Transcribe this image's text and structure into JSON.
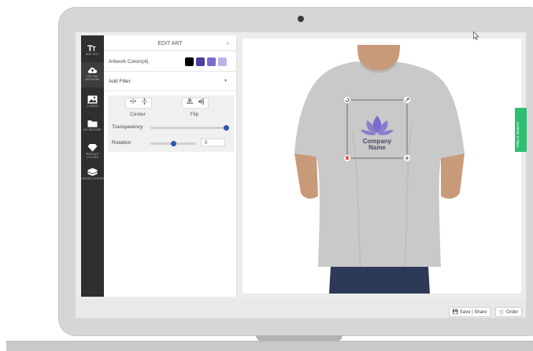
{
  "sidebar": {
    "items": [
      {
        "label": "ADD TEXT",
        "icon": "text-icon"
      },
      {
        "label": "UPLOAD ARTWORK",
        "icon": "cloud-upload-icon"
      },
      {
        "label": "CLIPART",
        "icon": "image-icon"
      },
      {
        "label": "MY DESIGNS",
        "icon": "folder-icon"
      },
      {
        "label": "PRODUCT COLORS",
        "icon": "diamond-icon"
      },
      {
        "label": "DESIGN LAYERS",
        "icon": "layers-icon"
      }
    ]
  },
  "panel": {
    "title": "EDIT ART",
    "close": "×",
    "artwork_colors_label": "Artwork Colors(4)",
    "artwork_colors": [
      "#000000",
      "#4b3fa0",
      "#7b6ad0",
      "#b9b2ec"
    ],
    "filter_label": "Add Filter",
    "filter_caret": "▾",
    "center_label": "Center",
    "flip_label": "Flip",
    "transparency_label": "Transparency",
    "transparency_level": 1.0,
    "rotation_label": "Rotation",
    "rotation_value": "0",
    "rotation_slider_level": 0.5
  },
  "canvas": {
    "logo_line1": "Company",
    "logo_line2": "Name",
    "logo_color": "#7b6ad0",
    "shirt_color": "#c9c9c9"
  },
  "help_tab": {
    "label": "Help & Support",
    "color": "#2fbf71"
  },
  "bottom": {
    "save_share": "Save | Share",
    "order": "Order"
  },
  "colors": {
    "sidebar_bg": "#2f2f2f",
    "accent": "#2b5aa8"
  }
}
